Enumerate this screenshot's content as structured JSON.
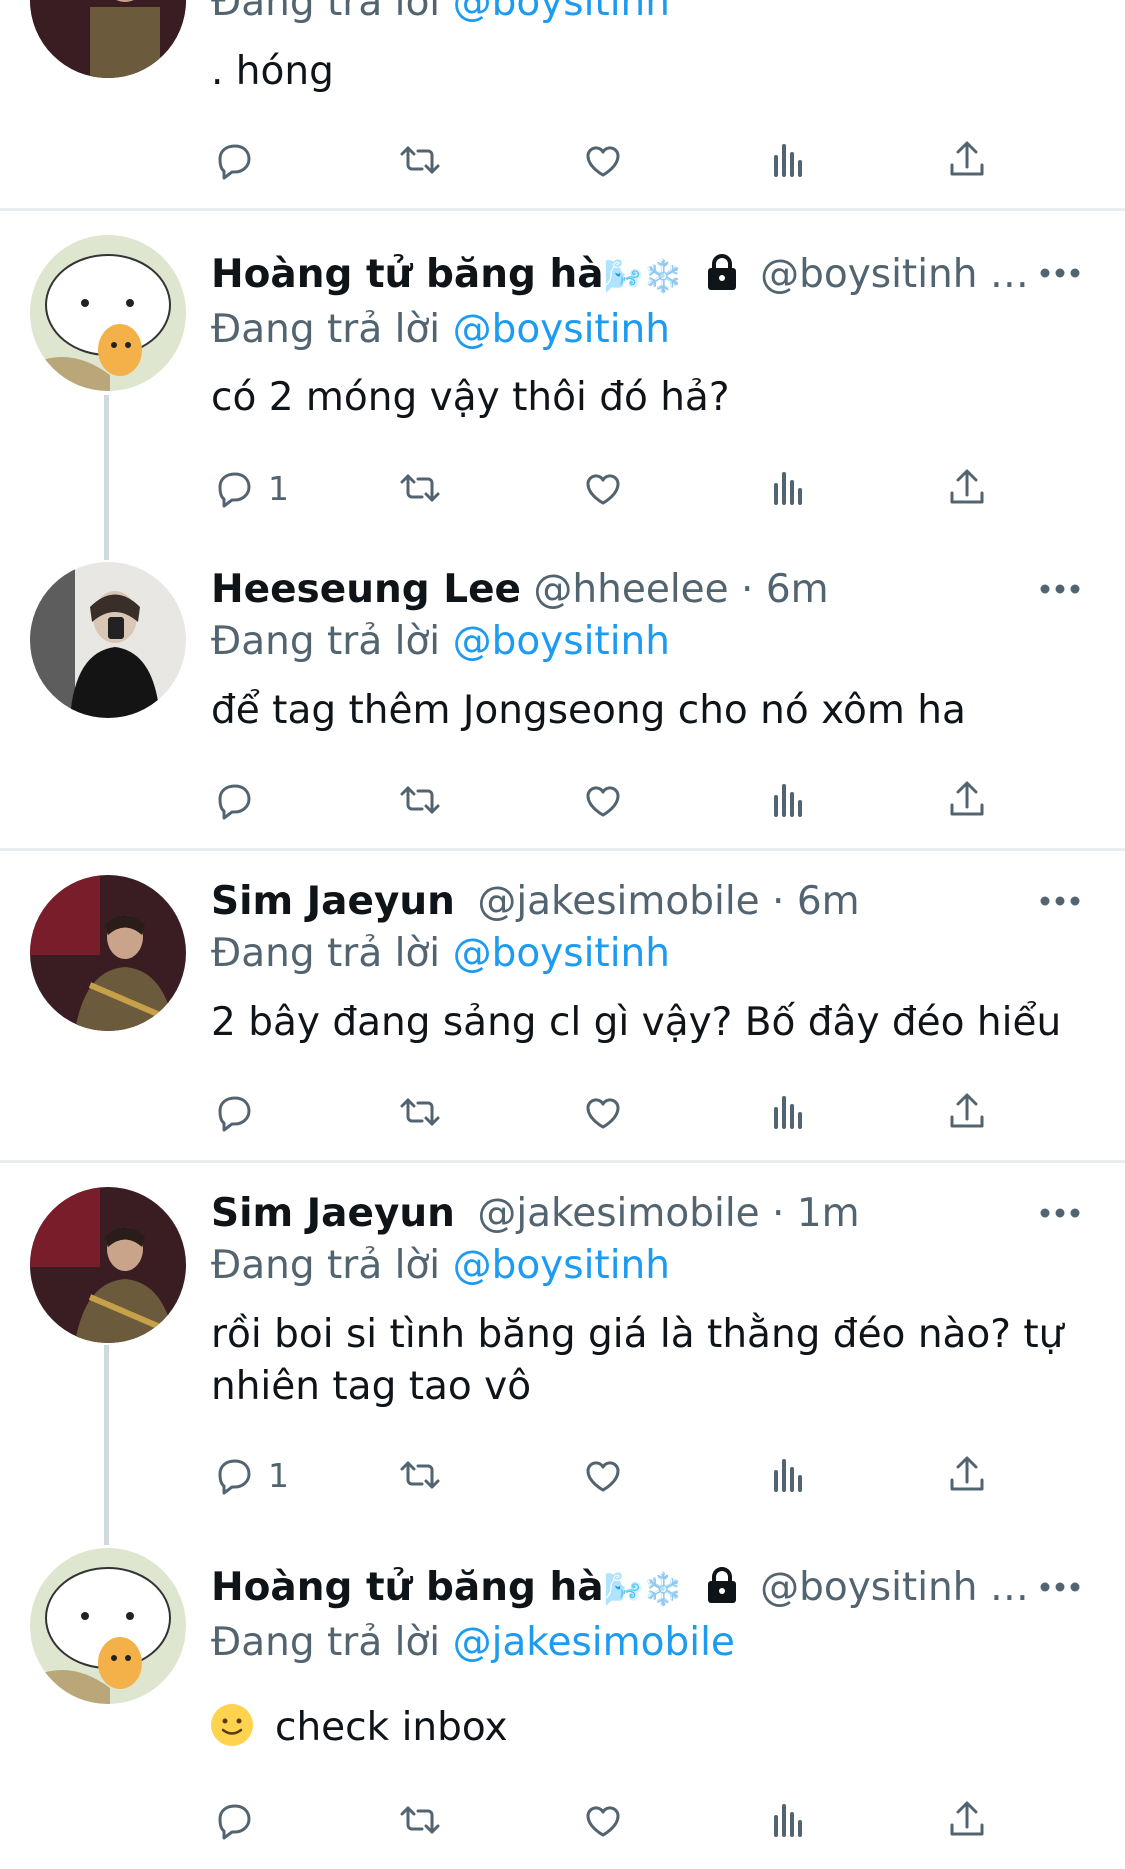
{
  "tweets": [
    {
      "reply_prefix": "Đang trả lời",
      "reply_to": "@boysitinh",
      "text": ". hóng",
      "reply_count": ""
    },
    {
      "name": "Hoàng tử băng hà",
      "emoji": "🌬️❄️",
      "handle": "@boysitinh …",
      "reply_prefix": "Đang trả lời",
      "reply_to": "@boysitinh",
      "text": "có 2 móng vậy thôi đó hả?",
      "reply_count": "1"
    },
    {
      "name": "Heeseung Lee",
      "handle": "@hheelee · 6m",
      "reply_prefix": "Đang trả lời",
      "reply_to": "@boysitinh",
      "text": "để tag thêm Jongseong cho nó xôm ha",
      "reply_count": ""
    },
    {
      "name": "Sim Jaeyun",
      "handle": "@jakesimobile · 6m",
      "reply_prefix": "Đang trả lời",
      "reply_to": "@boysitinh",
      "text": "2 bây đang sảng cl gì vậy? Bố đây đéo hiểu",
      "reply_count": ""
    },
    {
      "name": "Sim Jaeyun",
      "handle": "@jakesimobile · 1m",
      "reply_prefix": "Đang trả lời",
      "reply_to": "@boysitinh",
      "text": "rồi boi si tình băng giá là thằng đéo nào? tự nhiên tag tao vô",
      "reply_count": "1"
    },
    {
      "name": "Hoàng tử băng hà",
      "emoji": "🌬️❄️",
      "handle": "@boysitinh …",
      "reply_prefix": "Đang trả lời",
      "reply_to": "@jakesimobile",
      "text": "check inbox",
      "reply_count": ""
    }
  ],
  "icons": [
    "reply-icon",
    "retweet-icon",
    "like-icon",
    "analytics-icon",
    "share-icon",
    "more-icon",
    "lock-icon"
  ],
  "colors": {
    "accent": "#1d9bf0",
    "text": "#0f1419",
    "muted": "#536471",
    "divider": "#e6ecf0"
  }
}
